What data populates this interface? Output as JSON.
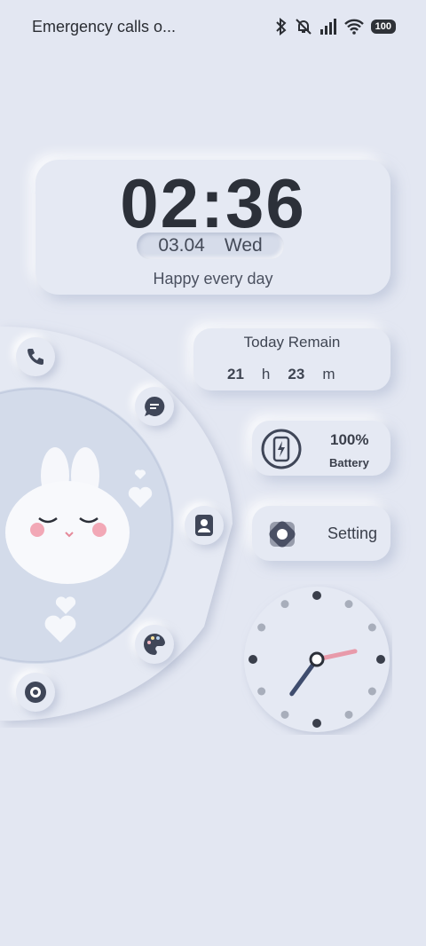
{
  "status_bar": {
    "text": "Emergency calls o...",
    "battery": "100"
  },
  "clock_widget": {
    "time": "02:36",
    "date": "03.04",
    "weekday": "Wed",
    "motto": "Happy every day"
  },
  "remain_widget": {
    "title": "Today Remain",
    "hours": "21",
    "hours_unit": "h",
    "minutes": "23",
    "minutes_unit": "m"
  },
  "battery_widget": {
    "percent": "100%",
    "label": "Battery"
  },
  "setting_widget": {
    "label": "Setting"
  },
  "app_arc": {
    "items": [
      "phone-icon",
      "message-icon",
      "contacts-icon",
      "theme-palette-icon",
      "camera-lens-icon"
    ]
  },
  "analog_clock": {
    "hour": 2,
    "minute": 36,
    "hour_hand_color": "#e89aaa",
    "minute_hand_color": "#3f4d6e"
  }
}
